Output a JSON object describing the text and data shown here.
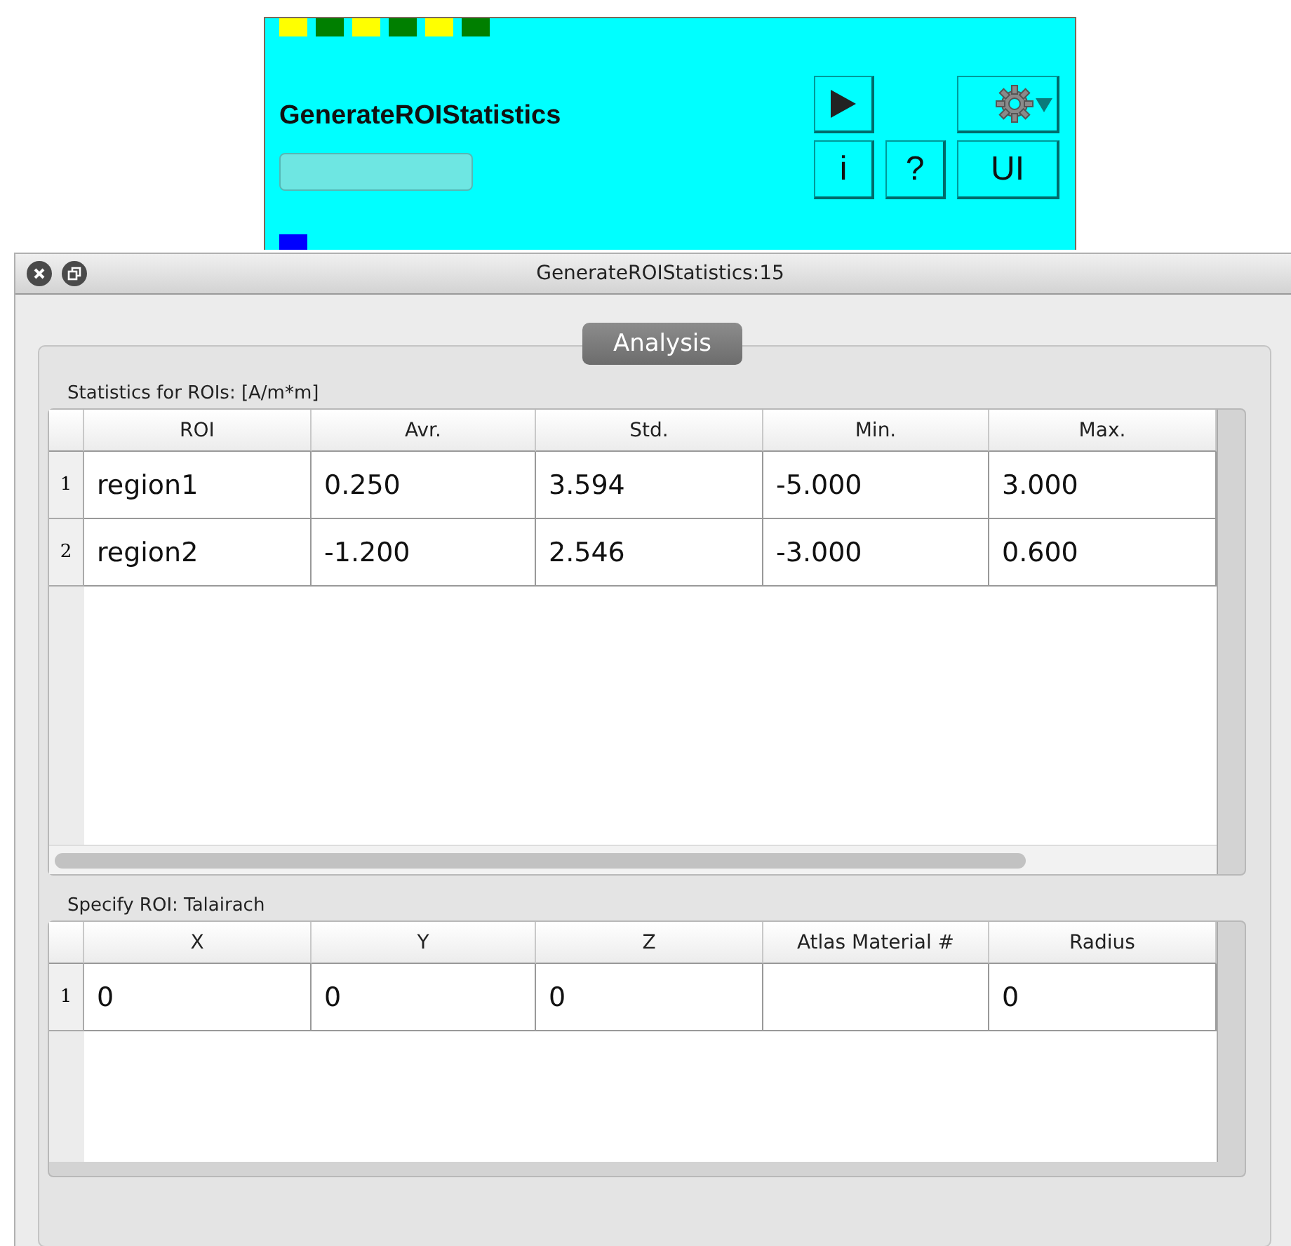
{
  "module": {
    "title": "GenerateROIStatistics",
    "input_ports": [
      {
        "color": "#ffff00"
      },
      {
        "color": "#007f00"
      },
      {
        "color": "#ffff00"
      },
      {
        "color": "#007f00"
      },
      {
        "color": "#ffff00"
      },
      {
        "color": "#007f00"
      }
    ],
    "output_ports": [
      {
        "color": "#0000ff"
      }
    ],
    "progress": {
      "level": 0
    },
    "buttons": [
      {
        "kind": "play"
      },
      {
        "kind": "gear"
      },
      {
        "kind": "text",
        "label": "i"
      },
      {
        "kind": "text",
        "label": "?"
      },
      {
        "kind": "text",
        "label": "UI"
      }
    ]
  },
  "window": {
    "title": "GenerateROIStatistics:15",
    "tab": "Analysis",
    "stats": {
      "label": "Statistics for ROIs: [A/m*m]",
      "columns": [
        "ROI",
        "Avr.",
        "Std.",
        "Min.",
        "Max."
      ],
      "rows": [
        {
          "index": "1",
          "cells": [
            "region1",
            "0.250",
            "3.594",
            "-5.000",
            "3.000"
          ]
        },
        {
          "index": "2",
          "cells": [
            "region2",
            "-1.200",
            "2.546",
            "-3.000",
            "0.600"
          ]
        }
      ]
    },
    "roi": {
      "label": "Specify ROI: Talairach",
      "columns": [
        "X",
        "Y",
        "Z",
        "Atlas Material #",
        "Radius"
      ],
      "rows": [
        {
          "index": "1",
          "cells": [
            "0",
            "0",
            "0",
            "",
            "0"
          ]
        }
      ]
    }
  }
}
